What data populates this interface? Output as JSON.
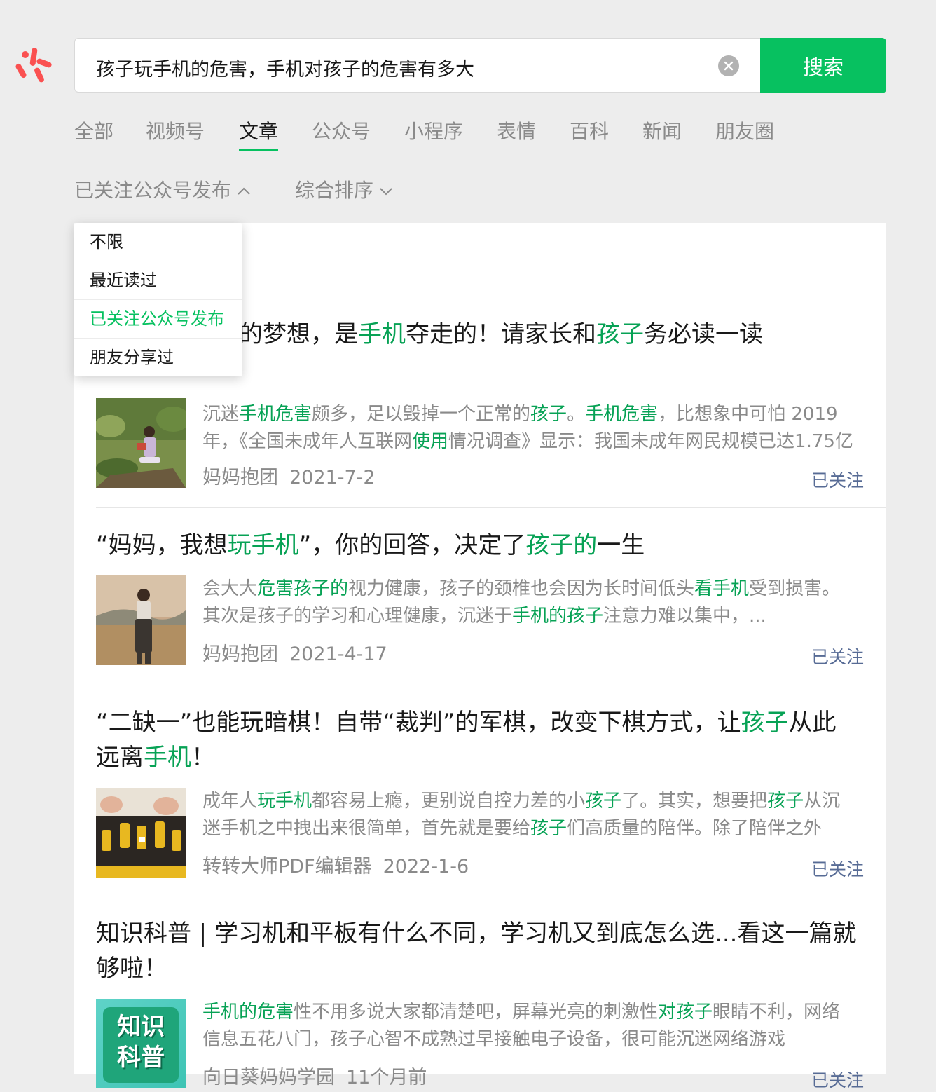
{
  "search": {
    "query": "孩子玩手机的危害，手机对孩子的危害有多大",
    "button_label": "搜索"
  },
  "tabs": [
    "全部",
    "视频号",
    "文章",
    "公众号",
    "小程序",
    "表情",
    "百科",
    "新闻",
    "朋友圈"
  ],
  "active_tab": "文章",
  "filters": {
    "source": "已关注公众号发布",
    "sort": "综合排序"
  },
  "dropdown": {
    "options": [
      "不限",
      "最近读过",
      "已关注公众号发布",
      "朋友分享过"
    ],
    "selected": "已关注公众号发布"
  },
  "articles": [
    {
      "title_parts": [
        {
          "t": "生的醒悟：我的梦想，是",
          "h": false
        },
        {
          "t": "手机",
          "h": true
        },
        {
          "t": "夺走的！请家长和",
          "h": false
        },
        {
          "t": "孩子",
          "h": true
        },
        {
          "t": "务必读一读",
          "h": false
        }
      ],
      "snippet_parts": [
        {
          "t": "沉迷",
          "h": false
        },
        {
          "t": "手机危害",
          "h": true
        },
        {
          "t": "颇多，足以毁掉一个正常的",
          "h": false
        },
        {
          "t": "孩子",
          "h": true
        },
        {
          "t": "。",
          "h": false
        },
        {
          "t": "手机危害",
          "h": true
        },
        {
          "t": "，比想象中可怕 2019年，《全国未成年人互联网",
          "h": false
        },
        {
          "t": "使用",
          "h": true
        },
        {
          "t": "情况调查》显示：我国未成年网民规模已达1.75亿",
          "h": false
        }
      ],
      "source": "妈妈抱团",
      "date": "2021-7-2",
      "followed": "已关注"
    },
    {
      "title_parts": [
        {
          "t": "“妈妈，我想",
          "h": false
        },
        {
          "t": "玩手机",
          "h": true
        },
        {
          "t": "”，你的回答，决定了",
          "h": false
        },
        {
          "t": "孩子的",
          "h": true
        },
        {
          "t": "一生",
          "h": false
        }
      ],
      "snippet_parts": [
        {
          "t": "会大大",
          "h": false
        },
        {
          "t": "危害孩子的",
          "h": true
        },
        {
          "t": "视力健康，孩子的颈椎也会因为长时间低头",
          "h": false
        },
        {
          "t": "看手机",
          "h": true
        },
        {
          "t": "受到损害。其次是孩子的学习和心理健康，沉迷于",
          "h": false
        },
        {
          "t": "手机的孩子",
          "h": true
        },
        {
          "t": "注意力难以集中，...",
          "h": false
        }
      ],
      "source": "妈妈抱团",
      "date": "2021-4-17",
      "followed": "已关注"
    },
    {
      "title_parts": [
        {
          "t": "“二缺一”也能玩暗棋！自带“裁判”的军棋，改变下棋方式，让",
          "h": false
        },
        {
          "t": "孩子",
          "h": true
        },
        {
          "t": "从此远离",
          "h": false
        },
        {
          "t": "手机",
          "h": true
        },
        {
          "t": "！",
          "h": false
        }
      ],
      "snippet_parts": [
        {
          "t": "成年人",
          "h": false
        },
        {
          "t": "玩手机",
          "h": true
        },
        {
          "t": "都容易上瘾，更别说自控力差的小",
          "h": false
        },
        {
          "t": "孩子",
          "h": true
        },
        {
          "t": "了。其实，想要把",
          "h": false
        },
        {
          "t": "孩子",
          "h": true
        },
        {
          "t": "从沉迷手机之中拽出来很简单，首先就是要给",
          "h": false
        },
        {
          "t": "孩子",
          "h": true
        },
        {
          "t": "们高质量的陪伴。除了陪伴之外",
          "h": false
        }
      ],
      "source": "转转大师PDF编辑器",
      "date": "2022-1-6",
      "followed": "已关注"
    },
    {
      "title_parts": [
        {
          "t": "知识科普 | 学习机和平板有什么不同，学习机又到底怎么选...看这一篇就够啦！",
          "h": false
        }
      ],
      "snippet_parts": [
        {
          "t": "手机的危害",
          "h": true
        },
        {
          "t": "性不用多说大家都清楚吧，屏幕光亮的刺激性",
          "h": false
        },
        {
          "t": "对孩子",
          "h": true
        },
        {
          "t": "眼睛不利，网络信息五花八门，孩子心智不成熟过早接触电子设备，很可能沉迷网络游戏",
          "h": false
        }
      ],
      "thumb_text": [
        "知识",
        "科普"
      ],
      "source": "向日葵妈妈学园",
      "date": "11个月前",
      "followed": "已关注"
    }
  ],
  "colors": {
    "accent": "#07c160",
    "highlight": "#07a255",
    "link": "#576b95",
    "muted": "#8a8a8a"
  }
}
